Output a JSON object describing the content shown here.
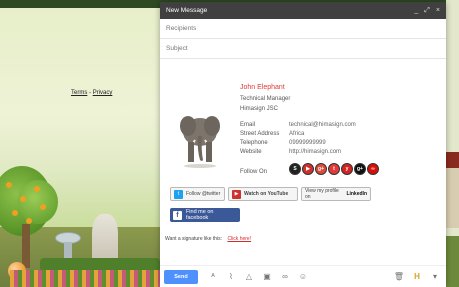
{
  "page": {
    "terms_label": "Terms",
    "separator": "-",
    "privacy_label": "Privacy"
  },
  "compose": {
    "title": "New Message",
    "controls": {
      "minimize": "_",
      "expand": "⤢",
      "close": "×"
    },
    "recipients_placeholder": "Recipients",
    "subject_placeholder": "Subject"
  },
  "signature": {
    "name": "John Elephant",
    "job_title": "Technical Manager",
    "company": "Himasign JSC",
    "rows": [
      {
        "label": "Email",
        "value": "technical@himasign.com"
      },
      {
        "label": "Street Address",
        "value": "Africa"
      },
      {
        "label": "Telephone",
        "value": "09999999999"
      },
      {
        "label": "Website",
        "value": "http://himasign.com"
      }
    ],
    "follow_on_label": "Follow On",
    "social_icons": [
      {
        "name": "skype-icon",
        "glyph": "S",
        "color": "#222222"
      },
      {
        "name": "youtube-icon",
        "glyph": "▶",
        "color": "#d0312d"
      },
      {
        "name": "google-plus-icon",
        "glyph": "g+",
        "color": "#dd4b39"
      },
      {
        "name": "twitter-icon",
        "glyph": "t",
        "color": "#e03a3a"
      },
      {
        "name": "yelp-icon",
        "glyph": "y",
        "color": "#d32323"
      },
      {
        "name": "google-plus-alt-icon",
        "glyph": "g+",
        "color": "#111111"
      },
      {
        "name": "lastfm-icon",
        "glyph": "∞",
        "color": "#d51007"
      }
    ],
    "twitter_button": "Follow @twitter",
    "youtube_button": "Watch on YouTube",
    "linkedin_button_prefix": "View my profile on",
    "linkedin_button_brand": "LinkedIn",
    "facebook_button": "Find me on facebook",
    "want_signature_text": "Want a signature like this:",
    "click_here": "Click here!"
  },
  "footer": {
    "send_label": "Send",
    "tools": [
      "format-text-icon",
      "attach-icon",
      "drive-icon",
      "photo-icon",
      "link-icon",
      "emoji-icon"
    ]
  },
  "colors": {
    "header_bg": "#404040",
    "send_blue": "#4d90fe",
    "name_red": "#e03a3a",
    "facebook_blue": "#3b5998"
  }
}
